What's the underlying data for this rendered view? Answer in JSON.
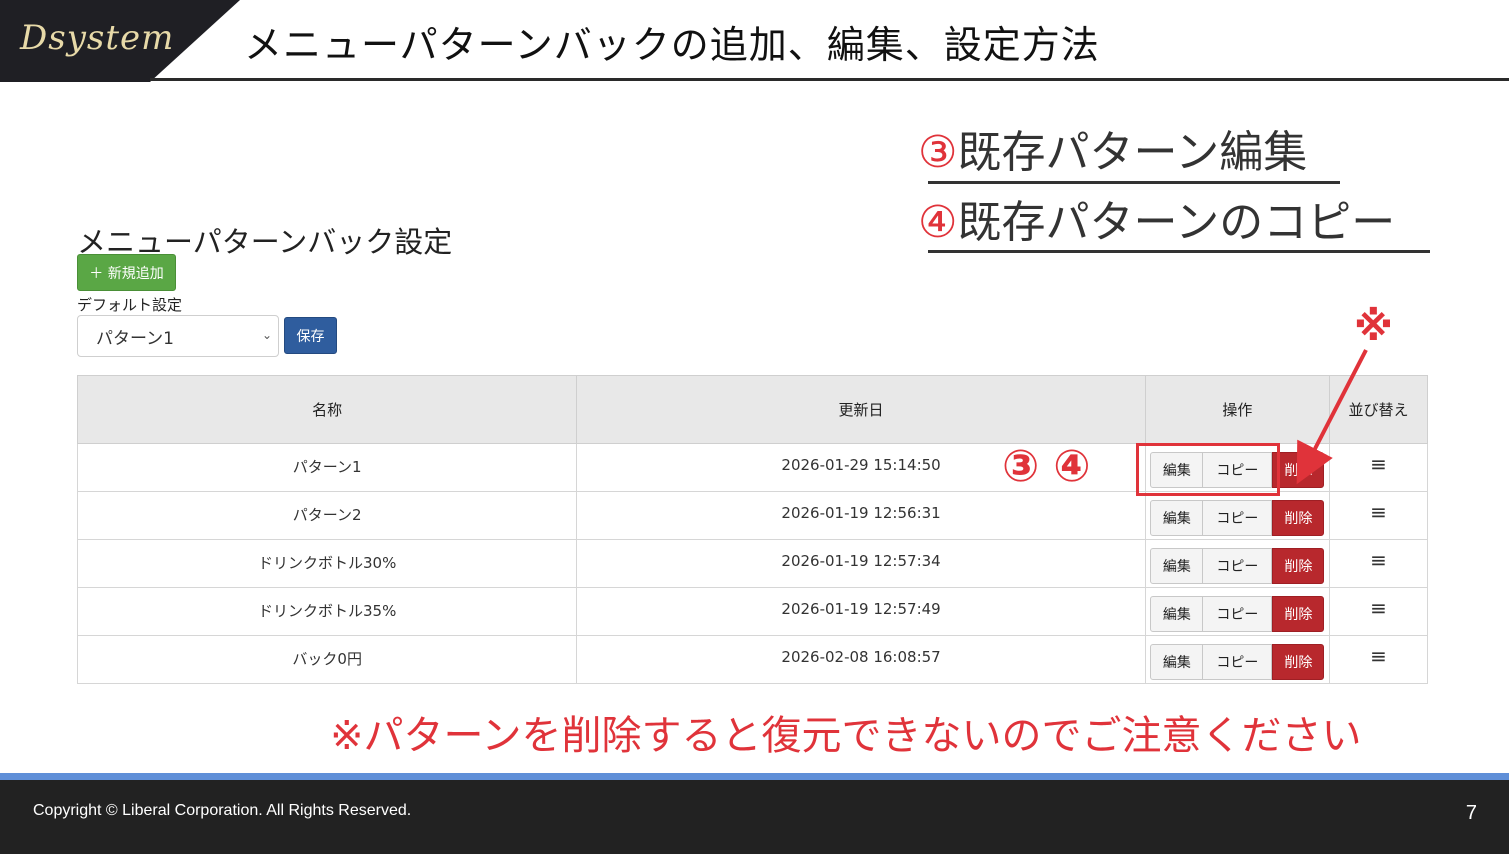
{
  "header": {
    "logo_text": "Dsystem",
    "title": "メニューパターンバックの追加、編集、設定方法"
  },
  "steps": [
    {
      "num": "③",
      "label": "既存パターン編集"
    },
    {
      "num": "④",
      "label": "既存パターンのコピー"
    }
  ],
  "panel": {
    "title": "メニューパターンバック設定",
    "new_button": "＋ 新規追加",
    "default_label": "デフォルト設定",
    "select_value": "パターン1",
    "save_button": "保存"
  },
  "table": {
    "headers": [
      "名称",
      "更新日",
      "操作",
      "並び替え"
    ],
    "actions": {
      "edit": "編集",
      "copy": "コピー",
      "delete": "削除"
    },
    "rows": [
      {
        "name": "パターン1",
        "date": "2026-01-29 15:14:50"
      },
      {
        "name": "パターン2",
        "date": "2026-01-19 12:56:31"
      },
      {
        "name": "ドリンクボトル30%",
        "date": "2026-01-19 12:57:34"
      },
      {
        "name": "ドリンクボトル35%",
        "date": "2026-01-19 12:57:49"
      },
      {
        "name": "バック0円",
        "date": "2026-02-08 16:08:57"
      }
    ]
  },
  "annotations": {
    "circled_numbers": "③④",
    "kome": "※",
    "warning": "※パターンを削除すると復元できないのでご注意ください"
  },
  "footer": {
    "copyright": "Copyright ©  Liberal Corporation. All Rights Reserved.",
    "page_number": "7"
  },
  "colors": {
    "accent_red": "#e0333a",
    "primary_green": "#5aa745",
    "primary_blue": "#2f5d9e",
    "danger": "#b8282d",
    "footer_bg": "#222222",
    "footer_line": "#5f8fd8"
  }
}
